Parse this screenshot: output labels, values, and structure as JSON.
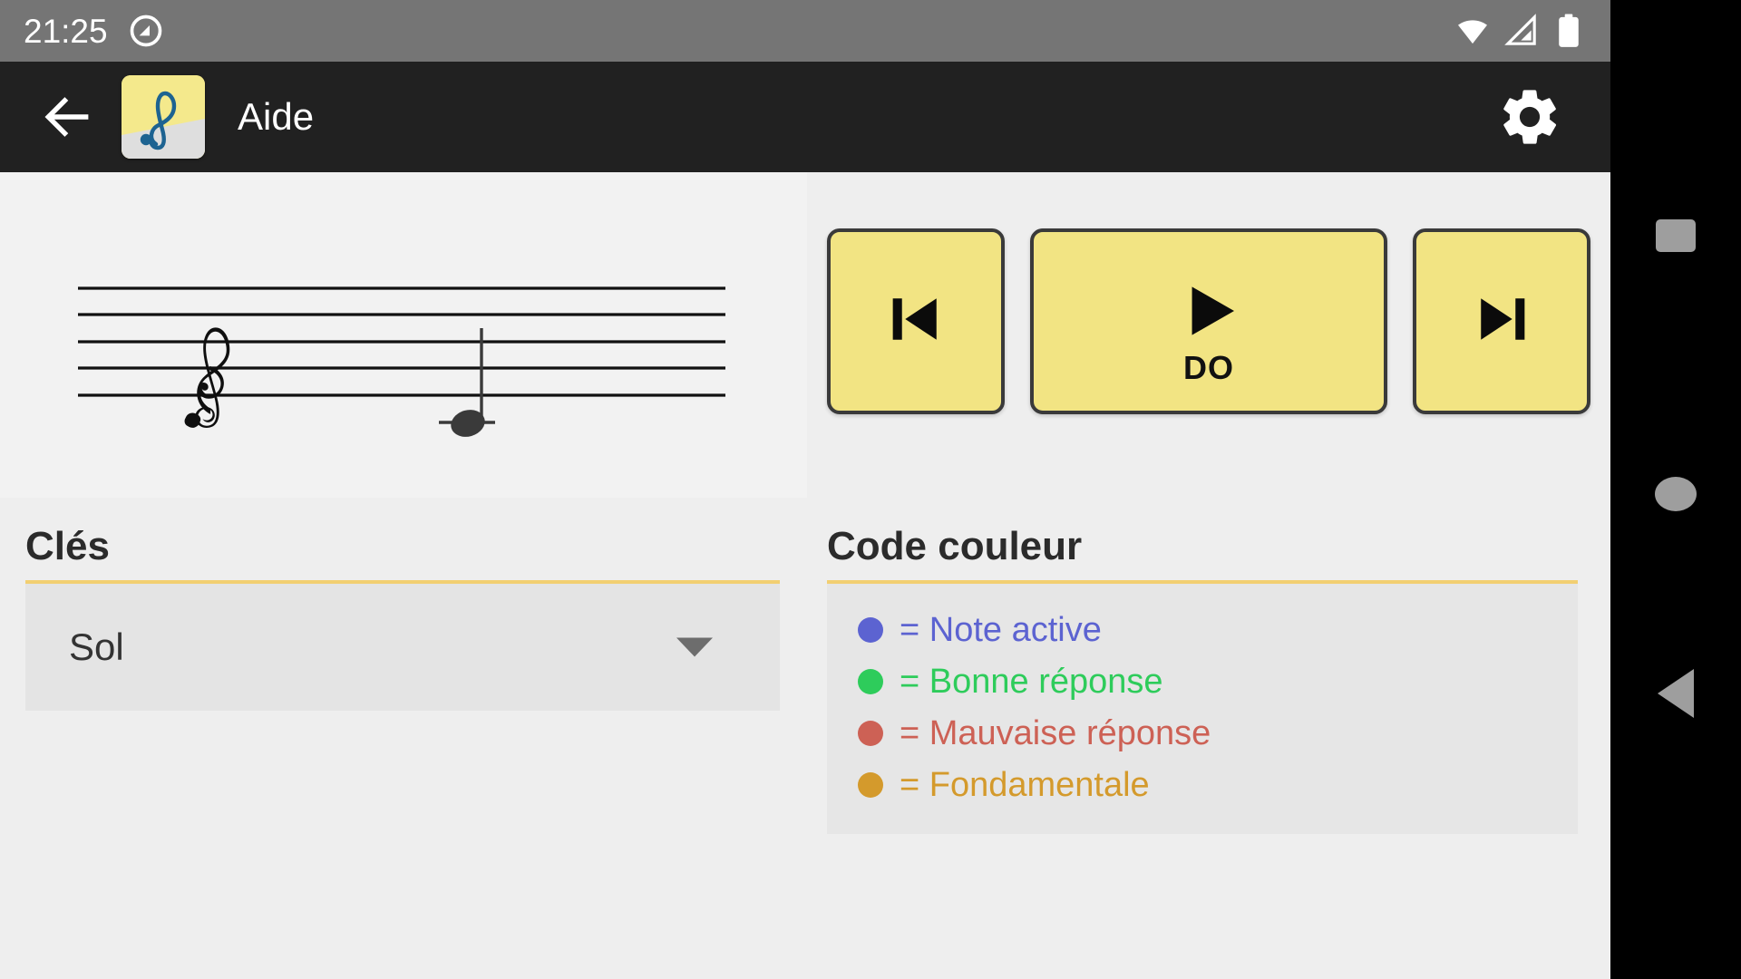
{
  "status_bar": {
    "clock": "21:25",
    "icons": [
      "auto-rotate-icon",
      "wifi-icon",
      "cellular-signal-icon",
      "battery-icon"
    ]
  },
  "app_bar": {
    "back_icon": "back-arrow-icon",
    "logo_icon": "treble-clef-app-logo",
    "title": "Aide",
    "settings_icon": "gear-icon"
  },
  "staff": {
    "clef_icon": "treble-clef",
    "note": {
      "name": "DO",
      "ledger_line": true,
      "stem": "up",
      "color": "#3a3a3a"
    },
    "line_count": 5,
    "background": "#f2f2f2"
  },
  "player": {
    "previous": {
      "label": "",
      "icon": "skip-previous-icon"
    },
    "play": {
      "label": "DO",
      "icon": "play-icon"
    },
    "next": {
      "label": "",
      "icon": "skip-next-icon"
    },
    "button_fill": "#f2e483",
    "button_border": "#3a3a3a"
  },
  "cles": {
    "title": "Clés",
    "selected": "Sol",
    "caret_icon": "chevron-down-icon",
    "rule_color": "#f2cf72"
  },
  "code_couleur": {
    "title": "Code couleur",
    "rule_color": "#f2cf72",
    "items": [
      {
        "label": "= Note active",
        "color": "#5c63d1"
      },
      {
        "label": "= Bonne réponse",
        "color": "#2ecc5b"
      },
      {
        "label": "= Mauvaise réponse",
        "color": "#cd6155"
      },
      {
        "label": "= Fondamentale",
        "color": "#d49a2c"
      }
    ]
  },
  "nav_bar": {
    "recents": "recents-square-icon",
    "home": "home-circle-icon",
    "back": "back-triangle-icon"
  }
}
